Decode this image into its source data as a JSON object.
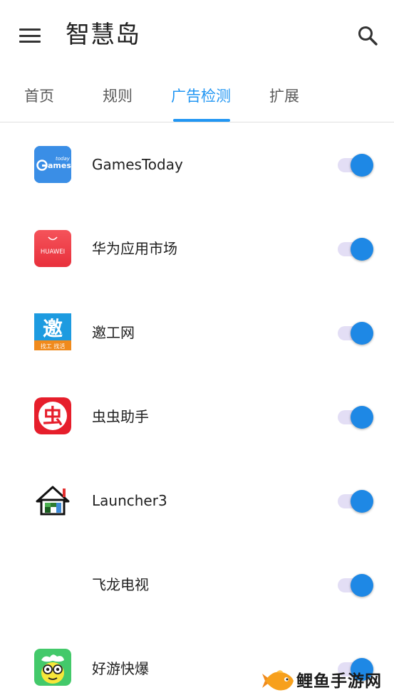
{
  "appbar": {
    "title": "智慧岛",
    "menu_icon": "menu-icon",
    "search_icon": "search-icon"
  },
  "tabs": [
    {
      "label": "首页",
      "active": false
    },
    {
      "label": "规则",
      "active": false
    },
    {
      "label": "广告检测",
      "active": true
    },
    {
      "label": "扩展",
      "active": false
    }
  ],
  "apps": [
    {
      "name": "GamesToday",
      "icon": "gamestoday-app-icon",
      "icon_text_top": "today",
      "icon_text": "ames",
      "enabled": true
    },
    {
      "name": "华为应用市场",
      "icon": "huawei-appgallery-icon",
      "icon_text": "HUAWEI",
      "enabled": true
    },
    {
      "name": "邀工网",
      "icon": "yaogongwang-app-icon",
      "icon_text": "邀",
      "icon_text_bottom": "找工 找活",
      "enabled": true
    },
    {
      "name": "虫虫助手",
      "icon": "chongchong-app-icon",
      "icon_text": "虫",
      "enabled": true
    },
    {
      "name": "Launcher3",
      "icon": "launcher-house-icon",
      "enabled": true
    },
    {
      "name": "飞龙电视",
      "icon": "",
      "enabled": true
    },
    {
      "name": "好游快爆",
      "icon": "haoyoukuaibao-app-icon",
      "enabled": true
    }
  ],
  "colors": {
    "accent": "#2196f3",
    "switch_thumb": "#1e88e5",
    "switch_track": "#e3def5"
  },
  "watermark": {
    "text": "鲤鱼手游网",
    "icon": "fish-logo-icon"
  }
}
